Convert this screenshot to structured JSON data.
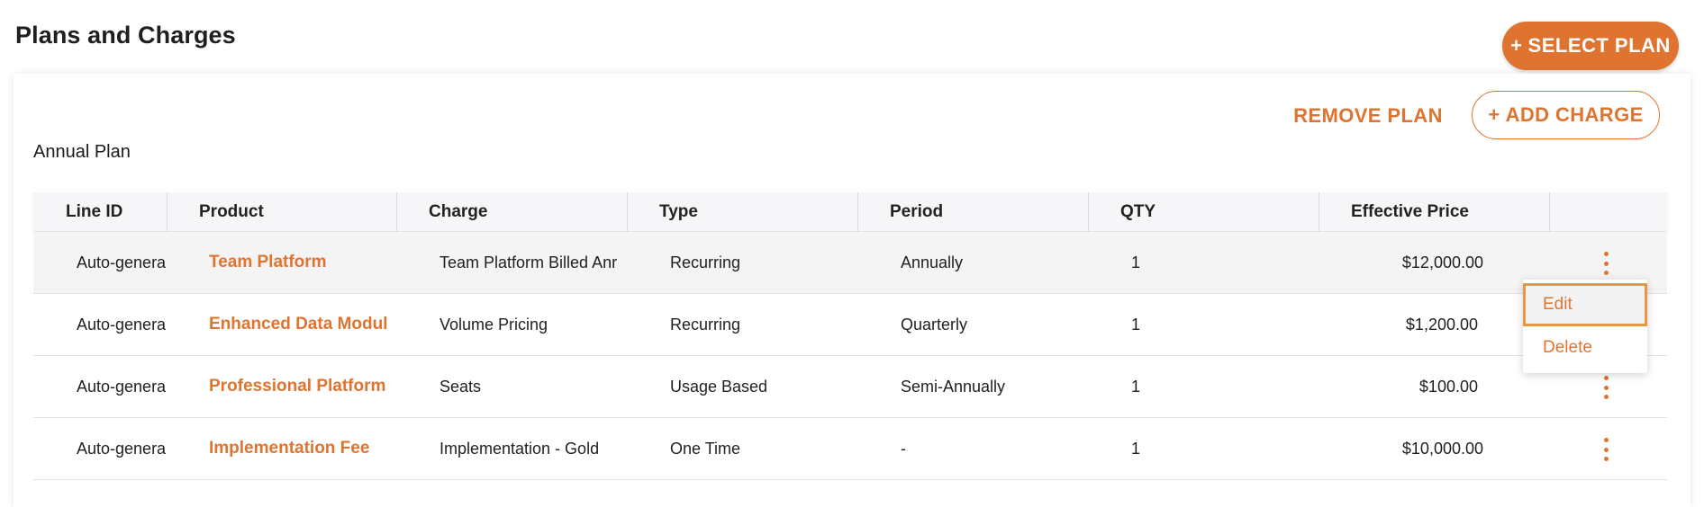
{
  "header": {
    "title": "Plans and Charges",
    "select_plan_label": "SELECT PLAN",
    "select_plan_icon": "plus-icon"
  },
  "plan": {
    "name": "Annual Plan",
    "remove_plan_label": "REMOVE PLAN",
    "add_charge_label": "ADD CHARGE",
    "add_charge_icon": "plus-icon"
  },
  "table": {
    "columns": [
      "Line ID",
      "Product",
      "Charge",
      "Type",
      "Period",
      "QTY",
      "Effective Price"
    ],
    "rows": [
      {
        "line_id": "Auto-genera",
        "product": "Team Platform",
        "charge": "Team Platform Billed Anr",
        "type": "Recurring",
        "period": "Annually",
        "qty": "1",
        "price": "$12,000.00"
      },
      {
        "line_id": "Auto-genera",
        "product": "Enhanced Data Modul",
        "charge": "Volume Pricing",
        "type": "Recurring",
        "period": "Quarterly",
        "qty": "1",
        "price": "$1,200.00"
      },
      {
        "line_id": "Auto-genera",
        "product": "Professional Platform",
        "charge": "Seats",
        "type": "Usage Based",
        "period": "Semi-Annually",
        "qty": "1",
        "price": "$100.00"
      },
      {
        "line_id": "Auto-genera",
        "product": "Implementation Fee",
        "charge": "Implementation - Gold",
        "type": "One Time",
        "period": "-",
        "qty": "1",
        "price": "$10,000.00"
      }
    ]
  },
  "row_menu": {
    "items": [
      "Edit",
      "Delete"
    ],
    "focused_item": "Edit"
  },
  "colors": {
    "accent": "#df7430",
    "header_bg": "#f6f6f8",
    "hover_row_bg": "#f4f4f4"
  }
}
